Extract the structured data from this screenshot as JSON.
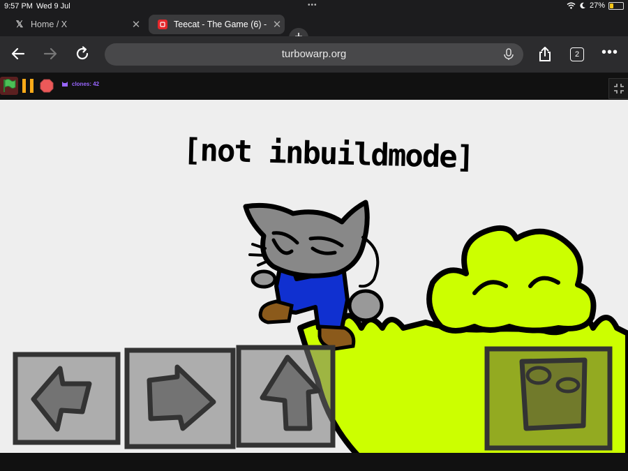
{
  "status_bar": {
    "time": "9:57 PM",
    "date": "Wed 9 Jul",
    "battery_percent": "27%",
    "battery_level": 0.27,
    "battery_color": "#f5c518"
  },
  "tabs": [
    {
      "title": "Home / X",
      "icon": "x-logo-icon",
      "active": false
    },
    {
      "title": "Teecat - The Game (6) - ...",
      "icon": "turbowarp-favicon-icon",
      "active": true
    }
  ],
  "toolbar": {
    "url": "turbowarp.org",
    "tab_count": "2"
  },
  "player_controls": {
    "clones_label": "clones: 42",
    "flag_color": "#4cbf56",
    "pause_color": "#ffab19",
    "stop_color": "#ec5959"
  },
  "game": {
    "mode_text": "[not inbuildmode]",
    "grass_color": "#ccff00",
    "buttons": [
      "left-arrow",
      "right-arrow",
      "jump-arrow",
      "trash-bin"
    ]
  }
}
